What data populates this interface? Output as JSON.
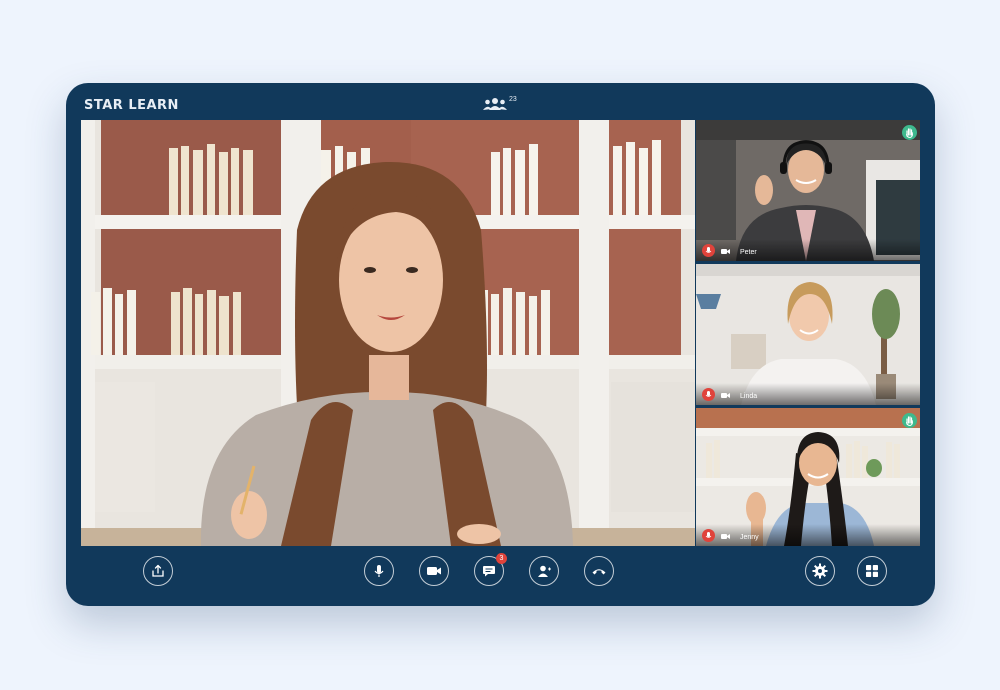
{
  "app": {
    "brand": "STAR LEARN",
    "participant_count": "23",
    "colors": {
      "frame": "#11395b",
      "page_bg": "#eef4fd",
      "mic_badge": "#e0433b",
      "hand_badge": "#3fb98d"
    }
  },
  "main_speaker": {
    "muted": false
  },
  "participants": [
    {
      "name": "Peter",
      "mic_muted": true,
      "hand_raised": true
    },
    {
      "name": "Linda",
      "mic_muted": true,
      "hand_raised": false
    },
    {
      "name": "Jenny",
      "mic_muted": true,
      "hand_raised": true
    }
  ],
  "controls": {
    "chat_unread": "3",
    "icons": [
      "share-screen-icon",
      "microphone-icon",
      "video-camera-icon",
      "chat-icon",
      "add-user-icon",
      "end-call-icon",
      "settings-gear-icon",
      "grid-layout-icon"
    ]
  }
}
